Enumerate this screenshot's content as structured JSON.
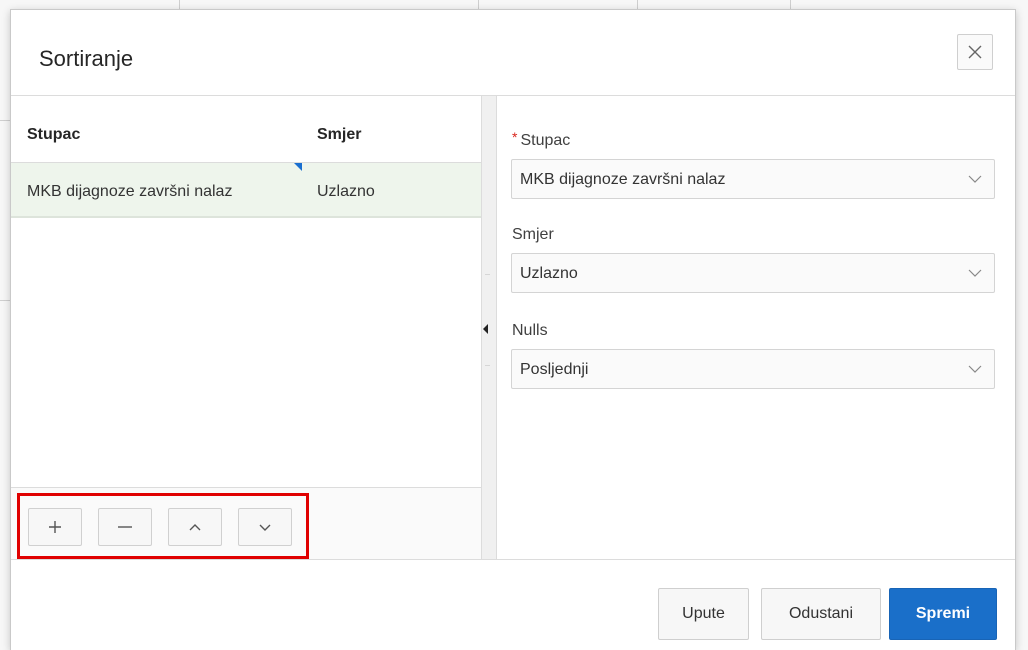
{
  "dialog": {
    "title": "Sortiranje"
  },
  "grid": {
    "columns": [
      "Stupac",
      "Smjer"
    ],
    "rows": [
      {
        "column": "MKB dijagnoze završni nalaz",
        "direction": "Uzlazno"
      }
    ]
  },
  "toolbar": {
    "buttons": [
      "add-icon",
      "remove-icon",
      "move-up-icon",
      "move-down-icon"
    ],
    "highlight_color": "#e00000"
  },
  "form": {
    "column_label": "Stupac",
    "column_required_mark": "*",
    "column_value": "MKB dijagnoze završni nalaz",
    "direction_label": "Smjer",
    "direction_value": "Uzlazno",
    "nulls_label": "Nulls",
    "nulls_value": "Posljednji"
  },
  "footer": {
    "help_label": "Upute",
    "cancel_label": "Odustani",
    "save_label": "Spremi",
    "primary_color": "#1a6fc9"
  }
}
